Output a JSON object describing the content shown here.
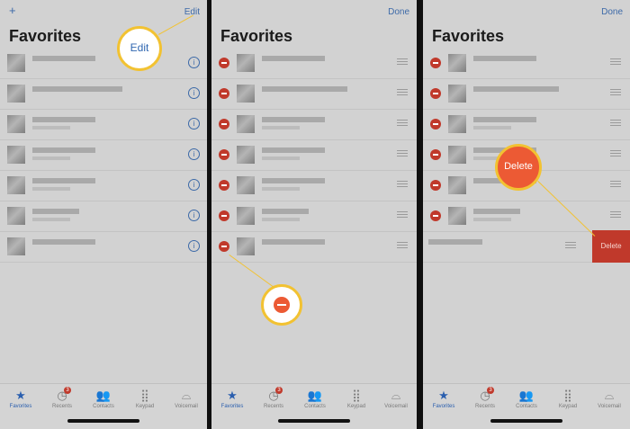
{
  "panel1": {
    "add_label": "+",
    "edit_label": "Edit",
    "title": "Favorites",
    "info_icon_glyph": "i",
    "callout_label": "Edit"
  },
  "panel2": {
    "done_label": "Done",
    "title": "Favorites",
    "callout_icon": "minus-circle-icon"
  },
  "panel3": {
    "done_label": "Done",
    "title": "Favorites",
    "delete_action_label": "Delete",
    "callout_label": "Delete"
  },
  "tabbar": {
    "tabs": [
      {
        "label": "Favorites",
        "icon": "star-icon",
        "active": true
      },
      {
        "label": "Recents",
        "icon": "clock-icon",
        "badge": "3"
      },
      {
        "label": "Contacts",
        "icon": "contacts-icon"
      },
      {
        "label": "Keypad",
        "icon": "keypad-icon"
      },
      {
        "label": "Voicemail",
        "icon": "voicemail-icon"
      }
    ]
  },
  "colors": {
    "accent_blue": "#3d6aa8",
    "delete_red": "#c0392b",
    "callout_yellow": "#f2c232",
    "callout_orange": "#ec5a34"
  }
}
